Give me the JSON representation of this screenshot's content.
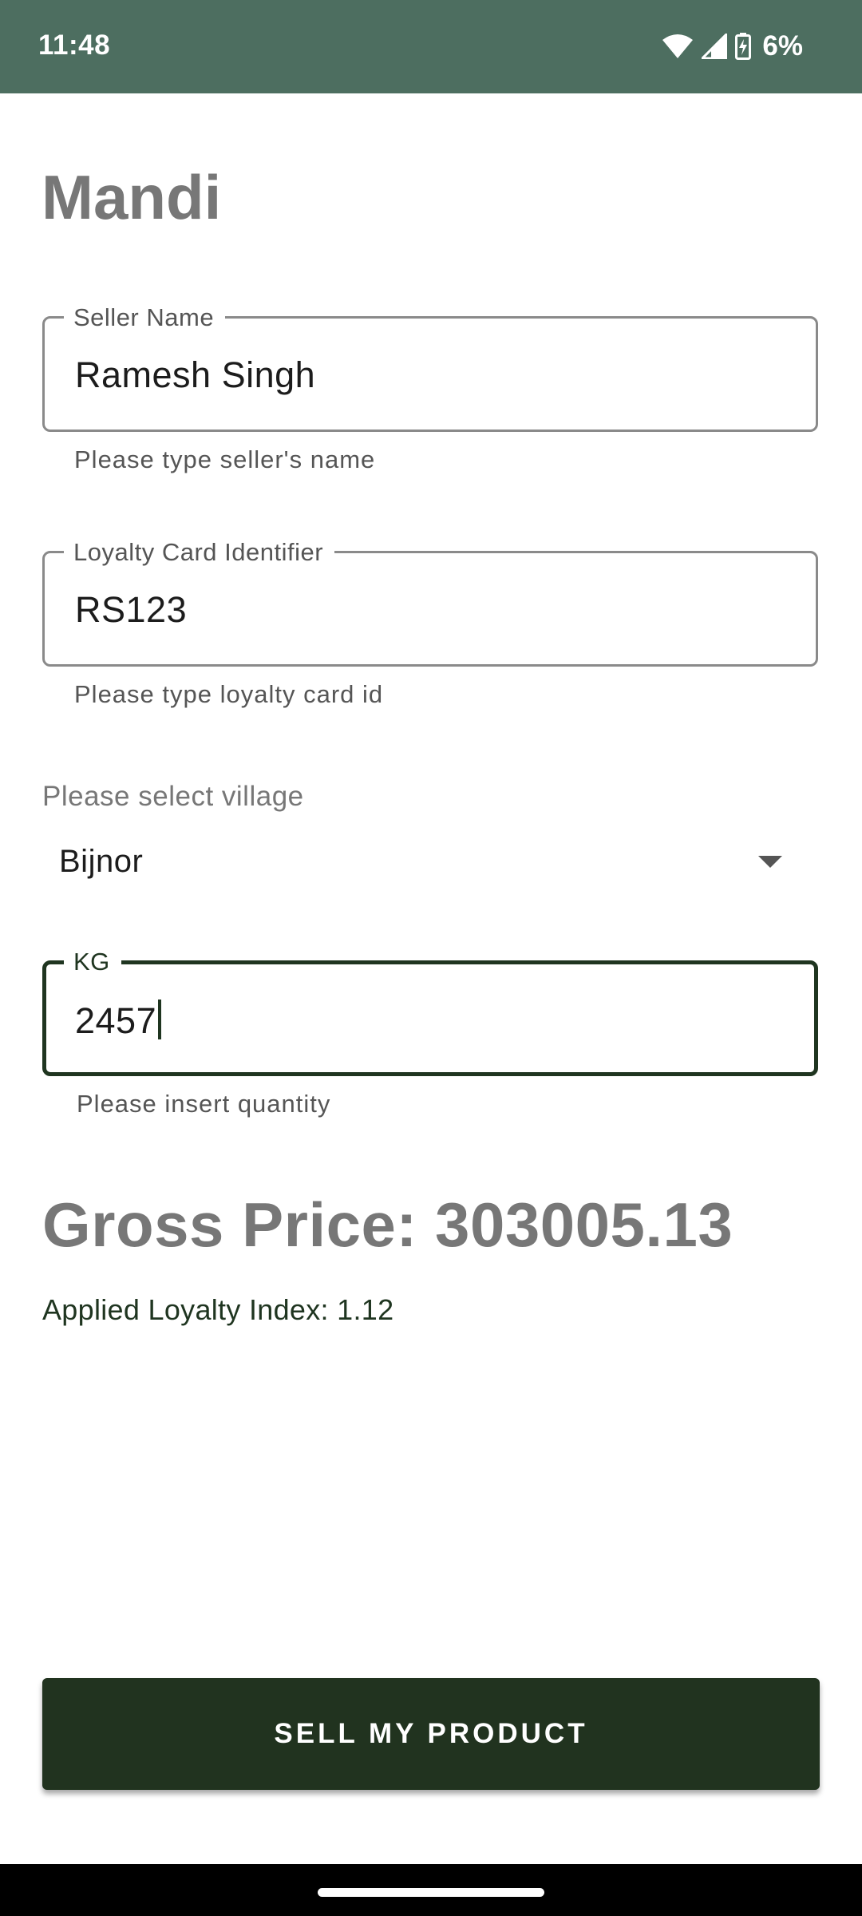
{
  "status_bar": {
    "time": "11:48",
    "battery_percent": "6%",
    "icons": [
      "wifi-icon",
      "signal-icon",
      "battery-charging-icon"
    ]
  },
  "app": {
    "title": "Mandi"
  },
  "form": {
    "seller_name": {
      "label": "Seller Name",
      "value": "Ramesh Singh",
      "helper": "Please type seller's name"
    },
    "loyalty_card": {
      "label": "Loyalty Card Identifier",
      "value": "RS123",
      "helper": "Please type loyalty card id"
    },
    "village": {
      "caption": "Please select village",
      "selected": "Bijnor"
    },
    "quantity": {
      "label": "KG",
      "value": "2457",
      "helper": "Please insert quantity"
    }
  },
  "result": {
    "gross_price": "Gross Price: 303005.13",
    "loyalty_index": "Applied Loyalty Index: 1.12"
  },
  "actions": {
    "sell_label": "SELL MY PRODUCT"
  },
  "colors": {
    "status_bar": "#4d6e60",
    "primary_dark": "#21331f",
    "title_gray": "#777777"
  }
}
